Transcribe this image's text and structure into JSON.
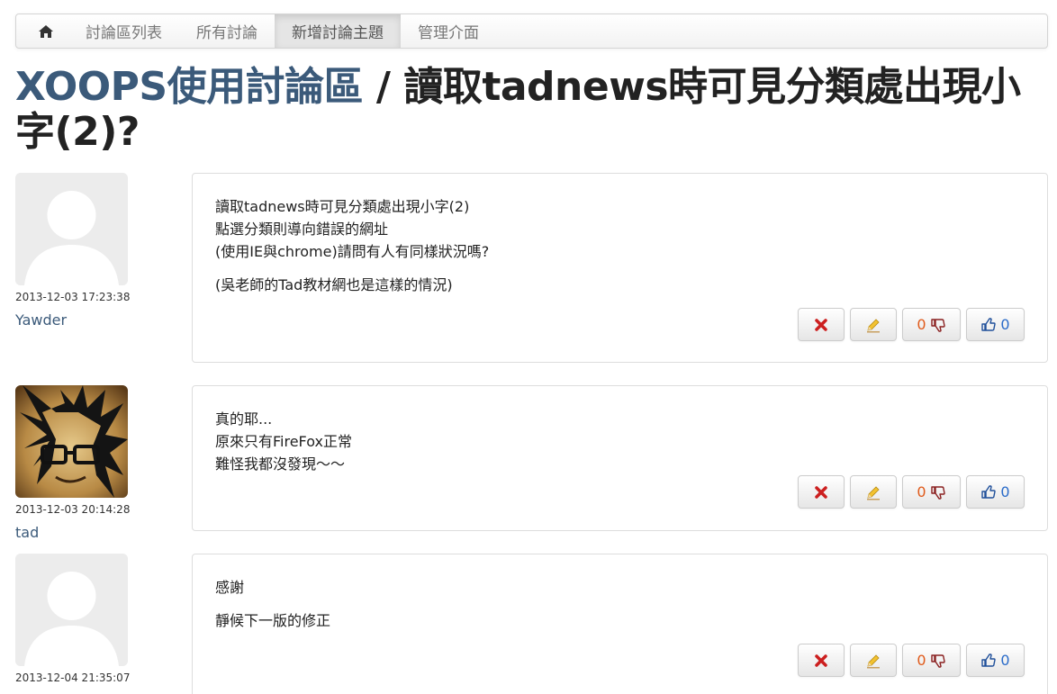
{
  "nav": {
    "home_icon": "home-icon",
    "items": [
      "討論區列表",
      "所有討論",
      "新增討論主題",
      "管理介面"
    ],
    "active_index": 2
  },
  "title": {
    "forum": "XOOPS使用討論區",
    "separator": " / ",
    "topic": "讀取tadnews時可見分類處出現小字(2)?"
  },
  "posts": [
    {
      "date": "2013-12-03 17:23:38",
      "author": "Yawder",
      "avatar": "default-avatar",
      "paragraphs": [
        [
          "讀取tadnews時可見分類處出現小字(2)",
          "點選分類則導向錯誤的網址",
          "(使用IE與chrome)請問有人有同樣狀況嗎?"
        ],
        [
          "(吳老師的Tad教材網也是這樣的情況)"
        ]
      ],
      "dislikes": "0",
      "likes": "0"
    },
    {
      "date": "2013-12-03 20:14:28",
      "author": "tad",
      "avatar": "photo-avatar",
      "paragraphs": [
        [
          "真的耶...",
          "原來只有FireFox正常",
          "難怪我都沒發現～～"
        ]
      ],
      "dislikes": "0",
      "likes": "0"
    },
    {
      "date": "2013-12-04 21:35:07",
      "author": "",
      "avatar": "default-avatar",
      "paragraphs": [
        [
          "感謝"
        ],
        [
          "靜候下一版的修正"
        ]
      ],
      "dislikes": "0",
      "likes": "0"
    }
  ],
  "colors": {
    "link": "#3b5a7a",
    "delete_icon": "#cc1f1f",
    "dislike_count": "#e05a1a",
    "like_count": "#2a6bc9"
  },
  "icons": [
    "home-icon",
    "delete-icon",
    "edit-icon",
    "thumbs-down-icon",
    "thumbs-up-icon"
  ]
}
